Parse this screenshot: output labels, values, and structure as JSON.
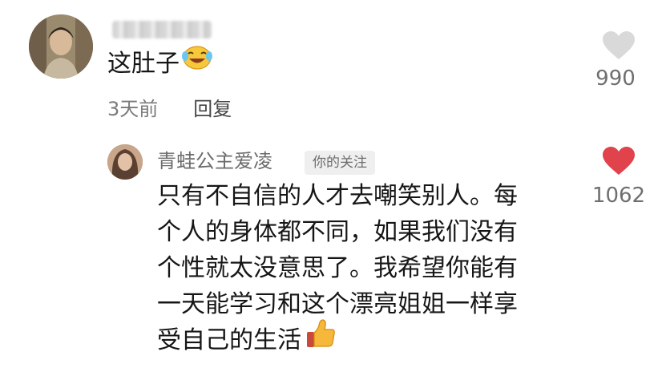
{
  "comment": {
    "text": "这肚子",
    "emoji": "laughing-crying-emoji",
    "time": "3天前",
    "reply_label": "回复",
    "likes": "990",
    "like_icon": "heart-icon-outline",
    "like_color": "#d9d9d9"
  },
  "reply": {
    "author": "青蛙公主爱凌",
    "tag": "你的关注",
    "lines": [
      "只有不自信的人才去嘲笑别人。每",
      "个人的身体都不同，如果我们没有",
      "个性就太没意思了。我希望你能有",
      "一天能学习和这个漂亮姐姐一样享",
      "受自己的生活"
    ],
    "emoji": "thumbs-up-emoji",
    "likes": "1062",
    "like_icon": "heart-icon-filled",
    "like_color": "#e0434b"
  }
}
